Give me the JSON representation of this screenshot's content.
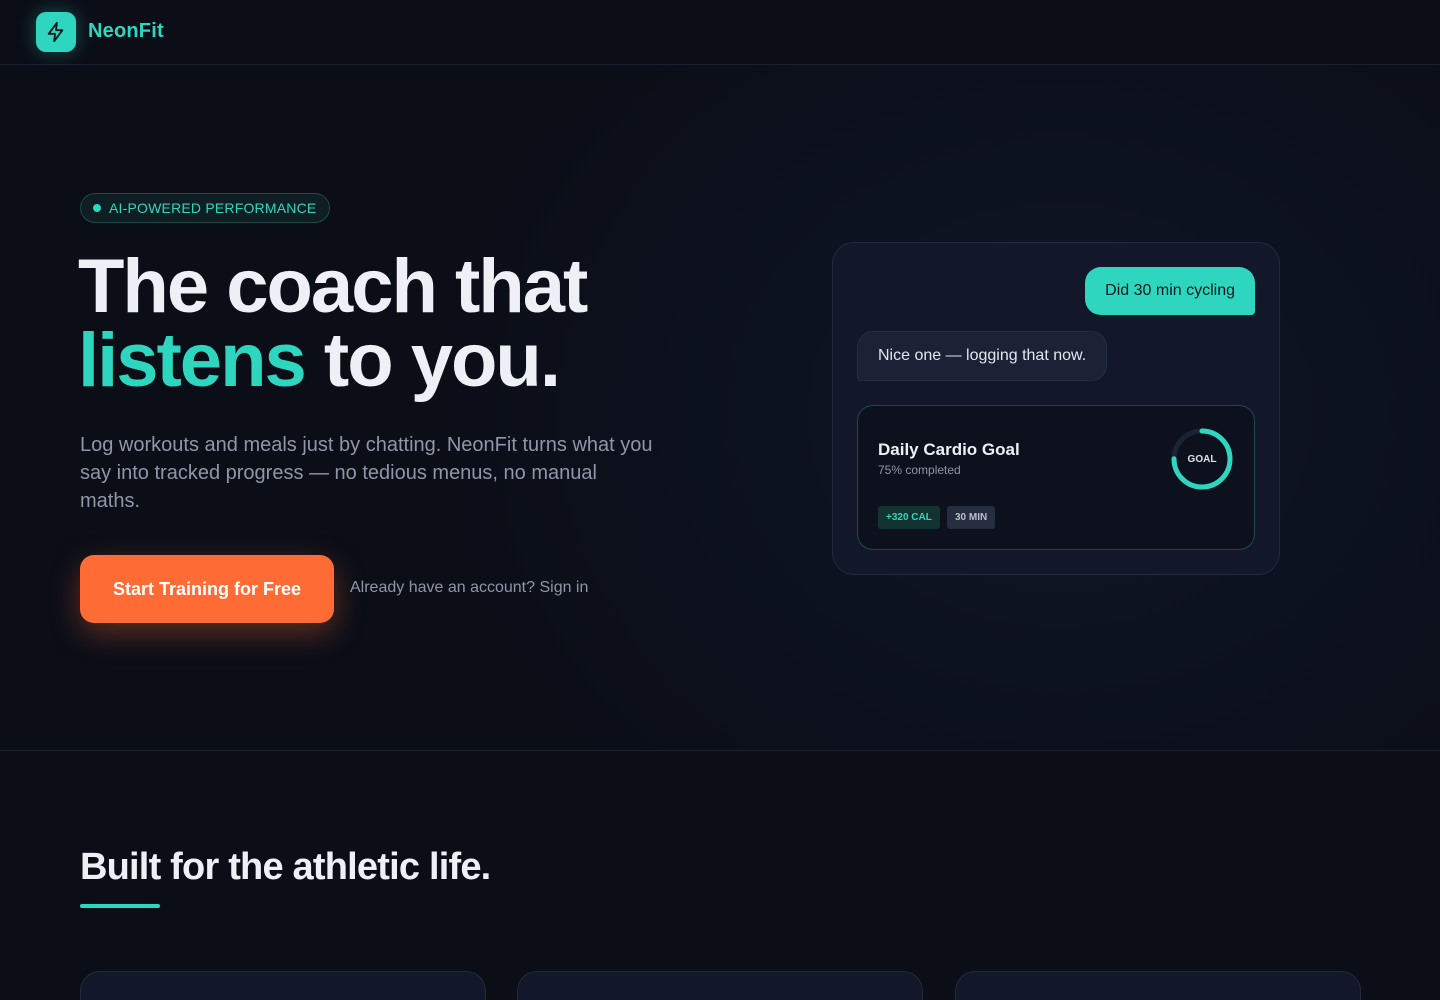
{
  "brand": {
    "name": "NeonFit",
    "logo_icon": "lightning-bolt-icon",
    "accent_color": "#2ed6c0",
    "cta_color": "#ff6b35",
    "background_color": "#0b0e17"
  },
  "hero": {
    "badge": "AI-POWERED PERFORMANCE",
    "headline_line1": "The coach that",
    "headline_accent": "listens",
    "headline_rest": " to you.",
    "subtext": "Log workouts and meals just by chatting. NeonFit turns what you say into tracked progress — no tedious menus, no manual maths.",
    "cta_label": "Start Training for Free",
    "signin_text": "Already have an account? Sign in"
  },
  "chat": {
    "user_message": "Did 30 min cycling",
    "bot_message": "Nice one — logging that now.",
    "goal": {
      "title": "Daily Cardio Goal",
      "subtitle": "75% completed",
      "progress": 0.75,
      "ring_label": "GOAL",
      "tags": [
        "+320 CAL",
        "30 MIN"
      ]
    }
  },
  "features": {
    "title": "Built for the athletic life."
  }
}
